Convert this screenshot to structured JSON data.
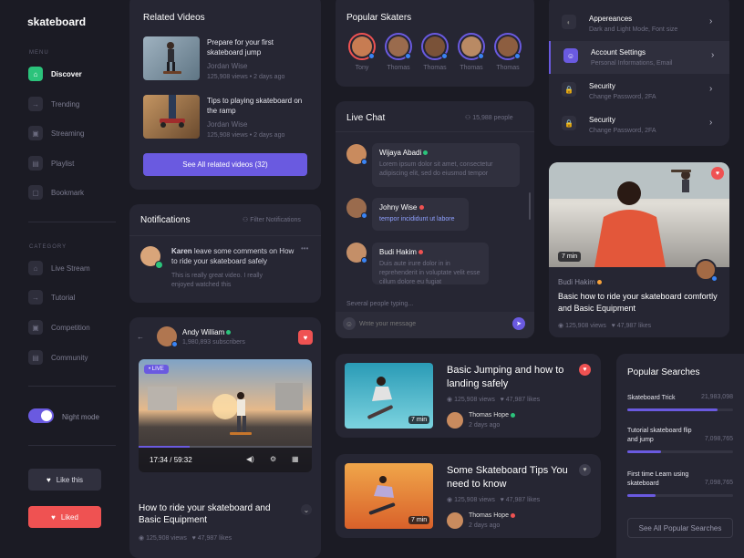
{
  "app": {
    "logo": "skateboard"
  },
  "sidebar": {
    "menu_label": "MENU",
    "menu": [
      {
        "label": "Discover",
        "icon": "home-icon",
        "active": true
      },
      {
        "label": "Trending",
        "icon": "arrow-icon",
        "active": false
      },
      {
        "label": "Streaming",
        "icon": "camera-icon",
        "active": false
      },
      {
        "label": "Playlist",
        "icon": "document-icon",
        "active": false
      },
      {
        "label": "Bookmark",
        "icon": "bookmark-icon",
        "active": false
      }
    ],
    "category_label": "CATEGORY",
    "category": [
      {
        "label": "Live Stream",
        "icon": "home-icon"
      },
      {
        "label": "Tutorial",
        "icon": "arrow-icon"
      },
      {
        "label": "Competition",
        "icon": "camera-icon"
      },
      {
        "label": "Community",
        "icon": "document-icon"
      }
    ],
    "night_mode_label": "Night mode",
    "like_label": "Like this",
    "liked_label": "Liked"
  },
  "related": {
    "title": "Related Videos",
    "items": [
      {
        "title": "Prepare for your first skateboard jump",
        "author": "Jordan Wise",
        "views": "125,908 views",
        "ago": "2 days ago"
      },
      {
        "title": "Tips to playing skateboard on the ramp",
        "author": "Jordan Wise",
        "views": "125,908 views",
        "ago": "2 days ago"
      }
    ],
    "see_all": "See All related videos (32)"
  },
  "notifications": {
    "title": "Notifications",
    "filter": "Filter Notifications",
    "user": "Karen",
    "text": " leave some comments on How to ride your skateboard safely",
    "quote": "This is really great video. I really enjoyed watched this"
  },
  "player": {
    "channel": "Andy William",
    "subscribers": "1,980,893 subscribers",
    "live": "• LIVE",
    "time": "17:34 / 59:32",
    "title": "How to ride your skateboard and Basic Equipment",
    "views": "125,908 views",
    "likes": "47,987 likes"
  },
  "skaters": {
    "title": "Popular Skaters",
    "names": [
      "Tony",
      "Thomas",
      "Thomas",
      "Thomas",
      "Thomas"
    ]
  },
  "chat": {
    "title": "Live Chat",
    "people": "15,988 people",
    "messages": [
      {
        "name": "Wijaya Abadi",
        "text": "Lorem ipsum dolor sit amet, consectetur adipiscing elit, sed do eiusmod tempor"
      },
      {
        "name": "Johny Wise",
        "text": "tempor incididunt ut labore"
      },
      {
        "name": "Budi Hakim",
        "text": "Duis aute irure dolor in in reprehenderit in voluptate velit esse cillum dolore eu fugiat"
      }
    ],
    "typing": "Several people typing...",
    "placeholder": "Write your message"
  },
  "settings": {
    "items": [
      {
        "title": "Appereances",
        "sub": "Dark and Light Mode, Font size"
      },
      {
        "title": "Account Settings",
        "sub": "Personal Informations, Email"
      },
      {
        "title": "Security",
        "sub": "Change Password, 2FA"
      },
      {
        "title": "Security",
        "sub": "Change Password, 2FA"
      }
    ]
  },
  "featured": {
    "duration": "7 min",
    "author": "Budi Hakim",
    "title": "Basic how to ride your skateboard comfortly and Basic Equipment",
    "views": "125,908 views",
    "likes": "47,987 likes"
  },
  "videos": [
    {
      "title": "Basic Jumping and how to landing safely",
      "views": "125,908 views",
      "likes": "47,987 likes",
      "author": "Thomas Hope",
      "ago": "2 days ago",
      "duration": "7 min"
    },
    {
      "title": "Some Skateboard Tips You need to know",
      "views": "125,908 views",
      "likes": "47,987 likes",
      "author": "Thomas Hope",
      "ago": "2 days ago",
      "duration": "7 min"
    }
  ],
  "searches": {
    "title": "Popular Searches",
    "items": [
      {
        "term": "Skateboard Trick",
        "count": "21,983,098",
        "level": 0.85
      },
      {
        "term": "Tutorial skateboard flip and jump",
        "count": "7,098,765",
        "level": 0.32
      },
      {
        "term": "First time Learn using skateboard",
        "count": "7,098,765",
        "level": 0.27
      }
    ],
    "see_all": "See All Popular Searches"
  },
  "colors": {
    "accent": "#6a5ae0",
    "green": "#2bc37b",
    "red": "#ef5252",
    "blue": "#3a84f5"
  }
}
